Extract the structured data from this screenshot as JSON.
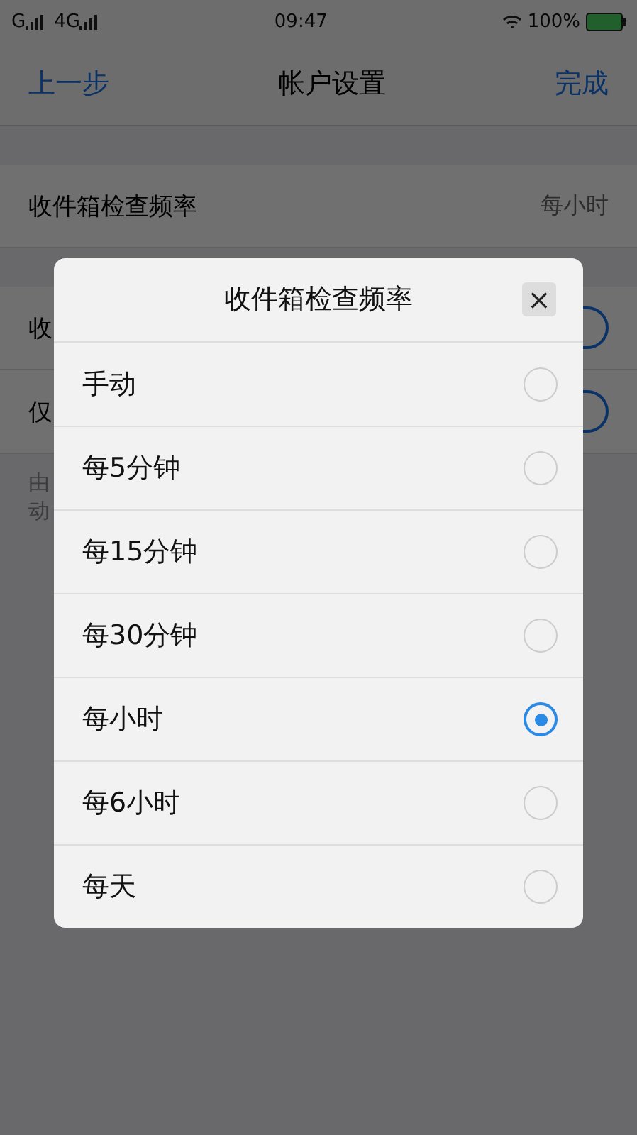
{
  "status_bar": {
    "carrier_1": "G",
    "carrier_2": "4G",
    "time": "09:47",
    "battery": "100%"
  },
  "nav": {
    "back": "上一步",
    "title": "帐户设置",
    "done": "完成"
  },
  "settings": [
    {
      "kind": "value",
      "label": "收件箱检查频率",
      "value": "每小时"
    },
    {
      "kind": "toggle",
      "label": "收",
      "on": true
    },
    {
      "kind": "toggle",
      "label": "仅",
      "on": true
    }
  ],
  "footnote": [
    "由",
    "动"
  ],
  "dialog": {
    "title": "收件箱检查频率",
    "close": "×",
    "options": [
      {
        "label": "手动",
        "selected": false
      },
      {
        "label": "每5分钟",
        "selected": false
      },
      {
        "label": "每15分钟",
        "selected": false
      },
      {
        "label": "每30分钟",
        "selected": false
      },
      {
        "label": "每小时",
        "selected": true
      },
      {
        "label": "每6小时",
        "selected": false
      },
      {
        "label": "每天",
        "selected": false
      }
    ]
  }
}
